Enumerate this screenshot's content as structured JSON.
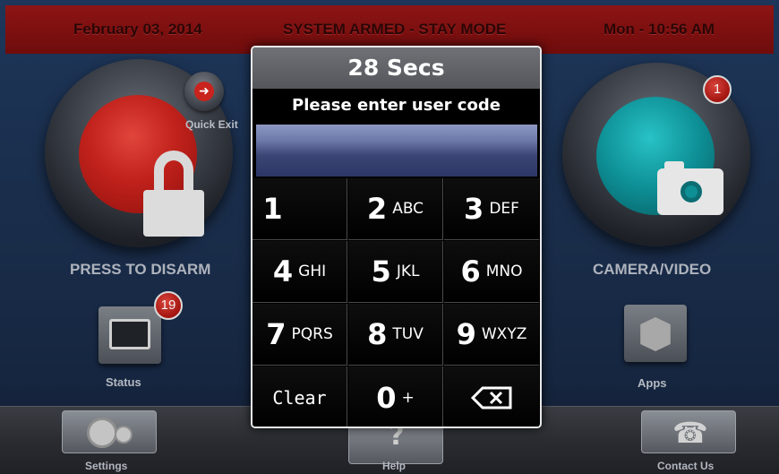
{
  "topbar": {
    "date": "February 03, 2014",
    "status": "SYSTEM ARMED - STAY MODE",
    "time": "Mon - 10:56 AM"
  },
  "home": {
    "disarm_label": "PRESS TO DISARM",
    "quick_exit_label": "Quick Exit",
    "camera_label": "CAMERA/VIDEO",
    "camera_badge": "1",
    "status_label": "Status",
    "status_badge": "19",
    "apps_label": "Apps"
  },
  "bottom": {
    "settings_label": "Settings",
    "help_label": "Help",
    "contact_label": "Contact Us"
  },
  "keypad_dialog": {
    "timer": "28  Secs",
    "prompt": "Please enter user code",
    "code_value": "",
    "keys": [
      {
        "num": "1",
        "letters": ""
      },
      {
        "num": "2",
        "letters": "ABC"
      },
      {
        "num": "3",
        "letters": "DEF"
      },
      {
        "num": "4",
        "letters": "GHI"
      },
      {
        "num": "5",
        "letters": "JKL"
      },
      {
        "num": "6",
        "letters": "MNO"
      },
      {
        "num": "7",
        "letters": "PQRS"
      },
      {
        "num": "8",
        "letters": "TUV"
      },
      {
        "num": "9",
        "letters": "WXYZ"
      },
      {
        "num": "0",
        "letters": "+"
      }
    ],
    "clear_label": "Clear",
    "backspace_icon": "backspace-icon"
  },
  "colors": {
    "topbar": "#7d1010",
    "disarm_button": "#c0211b",
    "camera_button": "#0d8f95",
    "code_field": "#4a5585"
  }
}
